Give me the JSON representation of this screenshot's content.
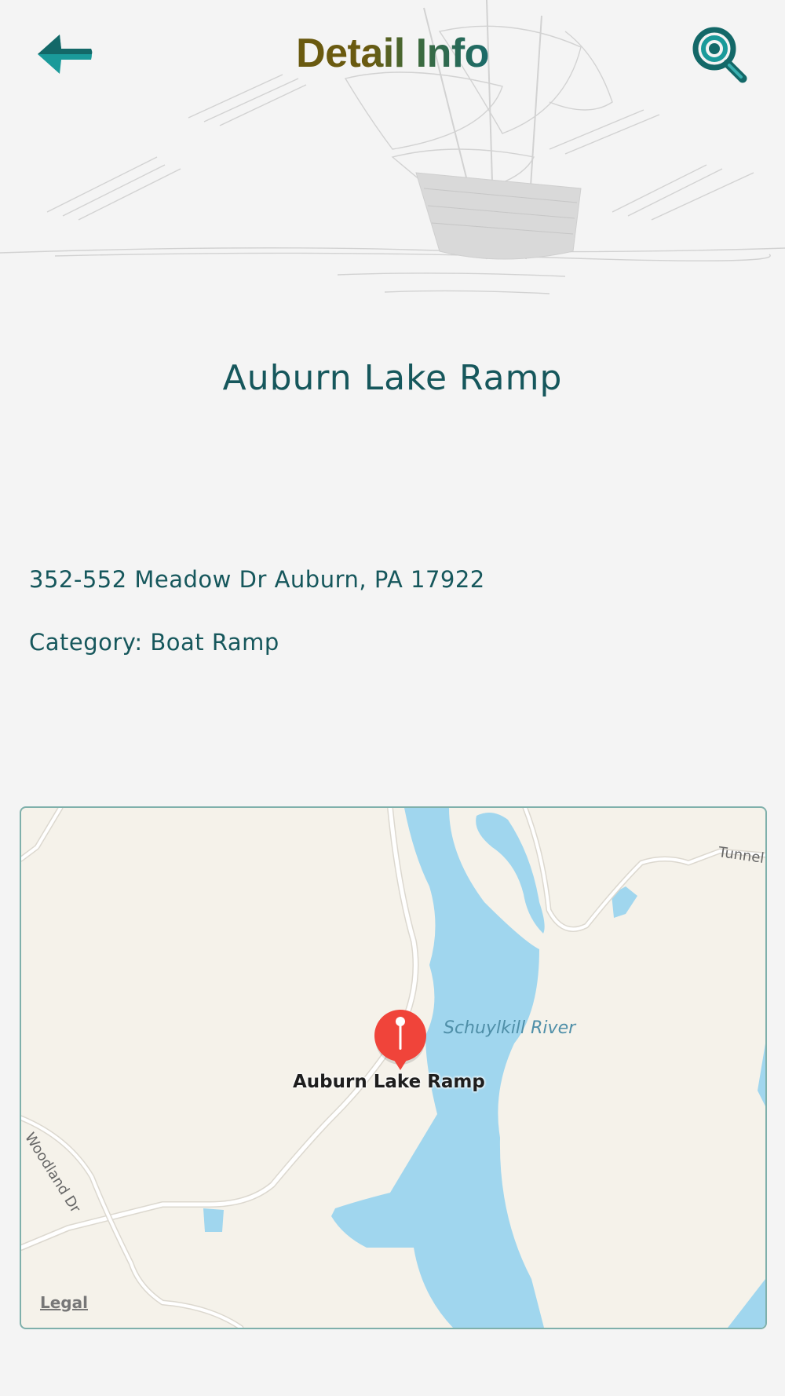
{
  "header": {
    "title": "Detail Info",
    "back_icon": "back-arrow-icon",
    "search_icon": "search-icon"
  },
  "place": {
    "name": "Auburn Lake Ramp",
    "address": "352-552 Meadow Dr Auburn, PA 17922",
    "category": "Category: Boat Ramp"
  },
  "map": {
    "pin_label": "Auburn Lake Ramp",
    "water_label": "Schuylkill River",
    "roads": [
      "Woodland Dr",
      "Tunnel"
    ],
    "legal_label": "Legal",
    "pin_icon": "map-pin-icon"
  },
  "colors": {
    "accent": "#16575c",
    "title_gold": "#6a5a10",
    "water": "#a0d6ee",
    "land": "#f5f2ea",
    "pin": "#f0443a"
  }
}
